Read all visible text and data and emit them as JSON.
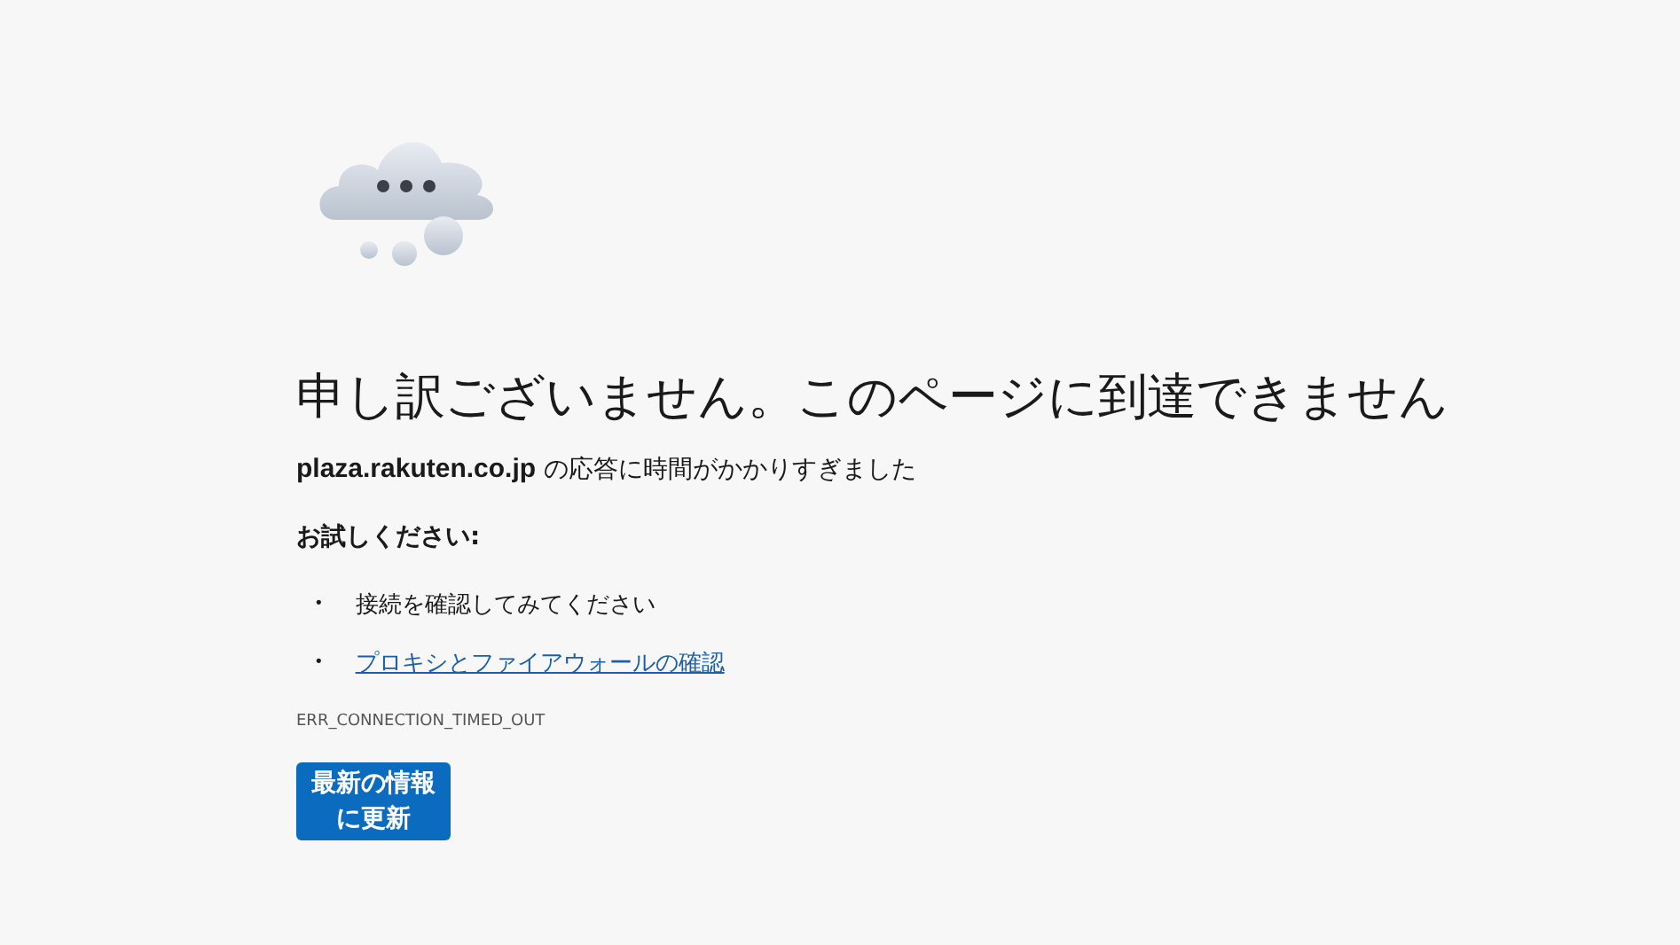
{
  "title": "申し訳ございません。このページに到達できません",
  "message": "**plaza.rakuten.co.jp** の応答に時間がかかりすぎました",
  "suggestions_heading": "お試しください:",
  "suggestions": [
    {
      "kind": "text",
      "bullet": "•",
      "text": "接続を確認してみてください"
    },
    {
      "kind": "link",
      "bullet": "•",
      "text": "プロキシとファイアウォールの確認"
    }
  ],
  "error_code": "ERR_CONNECTION_TIMED_OUT",
  "button": "最新の情報に更新"
}
